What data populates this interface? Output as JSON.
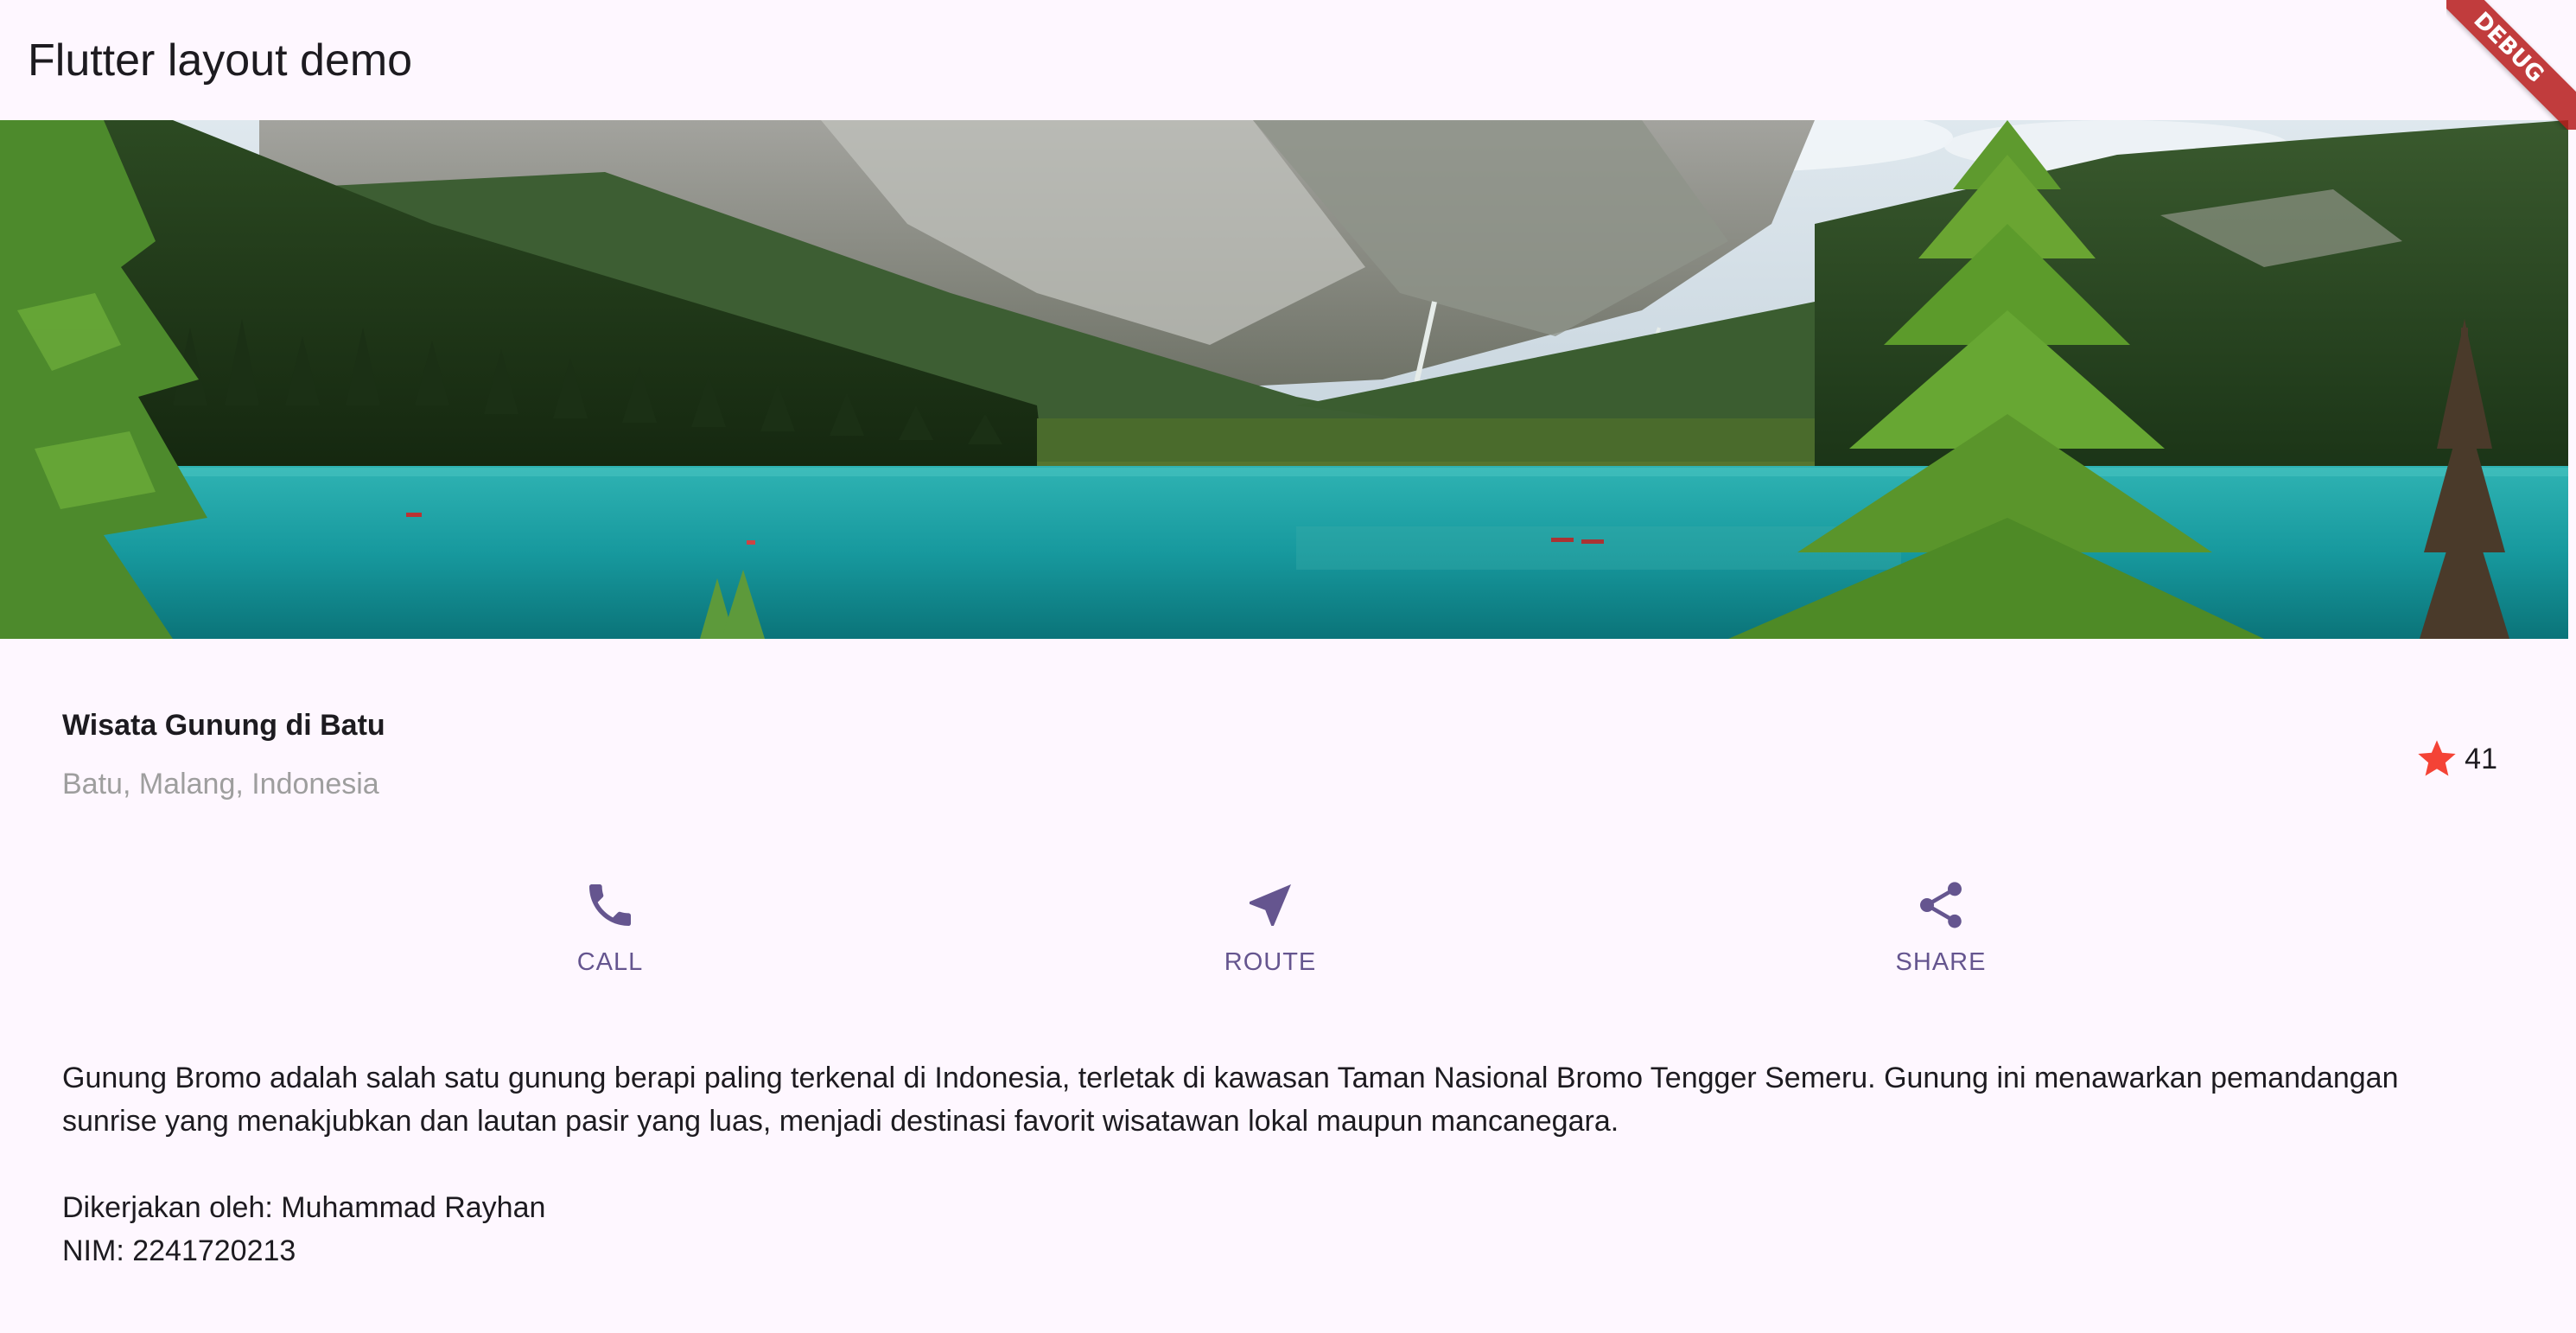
{
  "app_bar": {
    "title": "Flutter layout demo"
  },
  "debug_banner": {
    "label": "DEBUG"
  },
  "hero": {
    "icon": "mountain-lake-image"
  },
  "title_section": {
    "name": "Wisata Gunung di Batu",
    "location": "Batu, Malang, Indonesia",
    "rating_icon": "star-icon",
    "rating_count": "41"
  },
  "buttons": [
    {
      "label": "CALL",
      "icon": "phone-icon"
    },
    {
      "label": "ROUTE",
      "icon": "near-me-icon"
    },
    {
      "label": "SHARE",
      "icon": "share-icon"
    }
  ],
  "text_section": {
    "description": "Gunung Bromo adalah salah satu gunung berapi paling terkenal di Indonesia, terletak di kawasan Taman Nasional Bromo Tengger Semeru. Gunung ini menawarkan pemandangan sunrise yang menakjubkan dan lautan pasir yang luas, menjadi destinasi favorit wisatawan lokal maupun mancanegara.",
    "author": "Dikerjakan oleh: Muhammad Rayhan",
    "nim": "NIM: 2241720213"
  },
  "colors": {
    "background": "#fef7ff",
    "primary": "#65558f",
    "star": "#f44336",
    "subtitle": "#9e9e9e",
    "text": "#1d1b20"
  }
}
